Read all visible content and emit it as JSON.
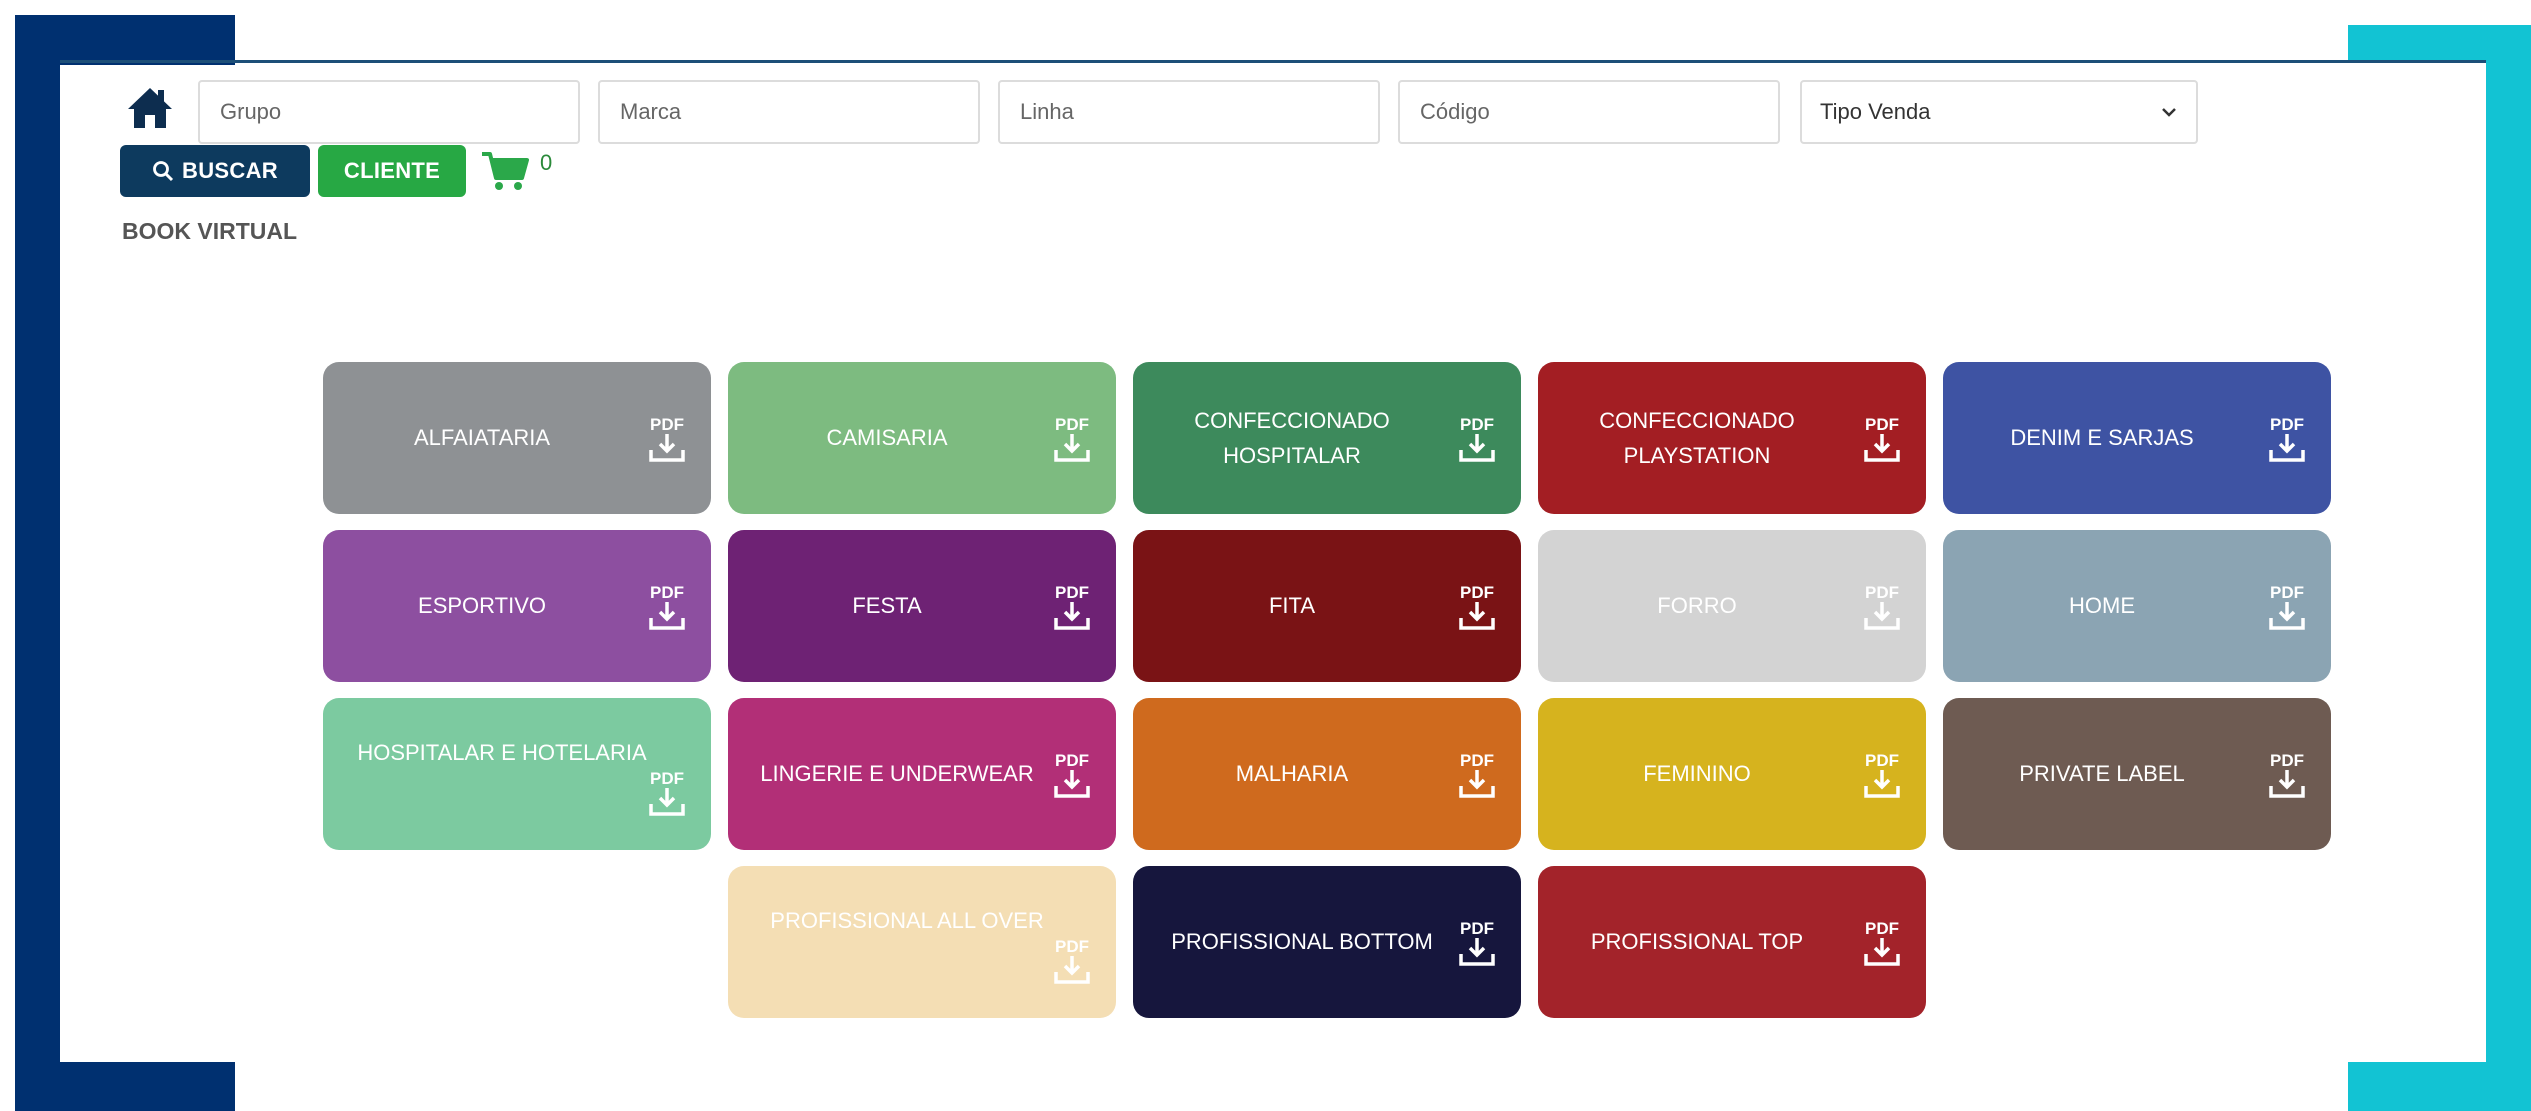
{
  "search": {
    "grupo_placeholder": "Grupo",
    "marca_placeholder": "Marca",
    "linha_placeholder": "Linha",
    "codigo_placeholder": "Código",
    "tipo_venda_selected": "Tipo Venda"
  },
  "toolbar": {
    "buscar_label": "BUSCAR",
    "cliente_label": "CLIENTE",
    "cart_count": "0"
  },
  "page_title": "BOOK VIRTUAL",
  "colors": {
    "frame_left": "#003070",
    "frame_right": "#12c3d3",
    "buscar": "#0d3a5e",
    "cliente": "#27a844"
  },
  "categories": [
    {
      "label": "ALFAIATARIA",
      "color": "#8e9194"
    },
    {
      "label": "CAMISARIA",
      "color": "#7dbb80"
    },
    {
      "label": "CONFECCIONADO HOSPITALAR",
      "color": "#3d8a5c"
    },
    {
      "label": "CONFECCIONADO PLAYSTATION",
      "color": "#a31e23"
    },
    {
      "label": "DENIM E SARJAS",
      "color": "#3e53a3"
    },
    {
      "label": "ESPORTIVO",
      "color": "#8d4fa0"
    },
    {
      "label": "FESTA",
      "color": "#6e2274"
    },
    {
      "label": "FITA",
      "color": "#7a1315"
    },
    {
      "label": "FORRO",
      "color": "#d3d3d3"
    },
    {
      "label": "HOME",
      "color": "#8ba4b3"
    },
    {
      "label": "HOSPITALAR E HOTELARIA",
      "color": "#7ccaa0"
    },
    {
      "label": "LINGERIE E UNDERWEAR",
      "color": "#b22f77"
    },
    {
      "label": "MALHARIA",
      "color": "#cf6a1e"
    },
    {
      "label": "FEMININO",
      "color": "#d6b31e"
    },
    {
      "label": "PRIVATE LABEL",
      "color": "#6e5b52"
    },
    {
      "label": "PROFISSIONAL ALL OVER",
      "color": "#f4deb4"
    },
    {
      "label": "PROFISSIONAL BOTTOM",
      "color": "#16163d"
    },
    {
      "label": "PROFISSIONAL TOP",
      "color": "#a3232a"
    }
  ],
  "pdf_icon_text": "PDF"
}
